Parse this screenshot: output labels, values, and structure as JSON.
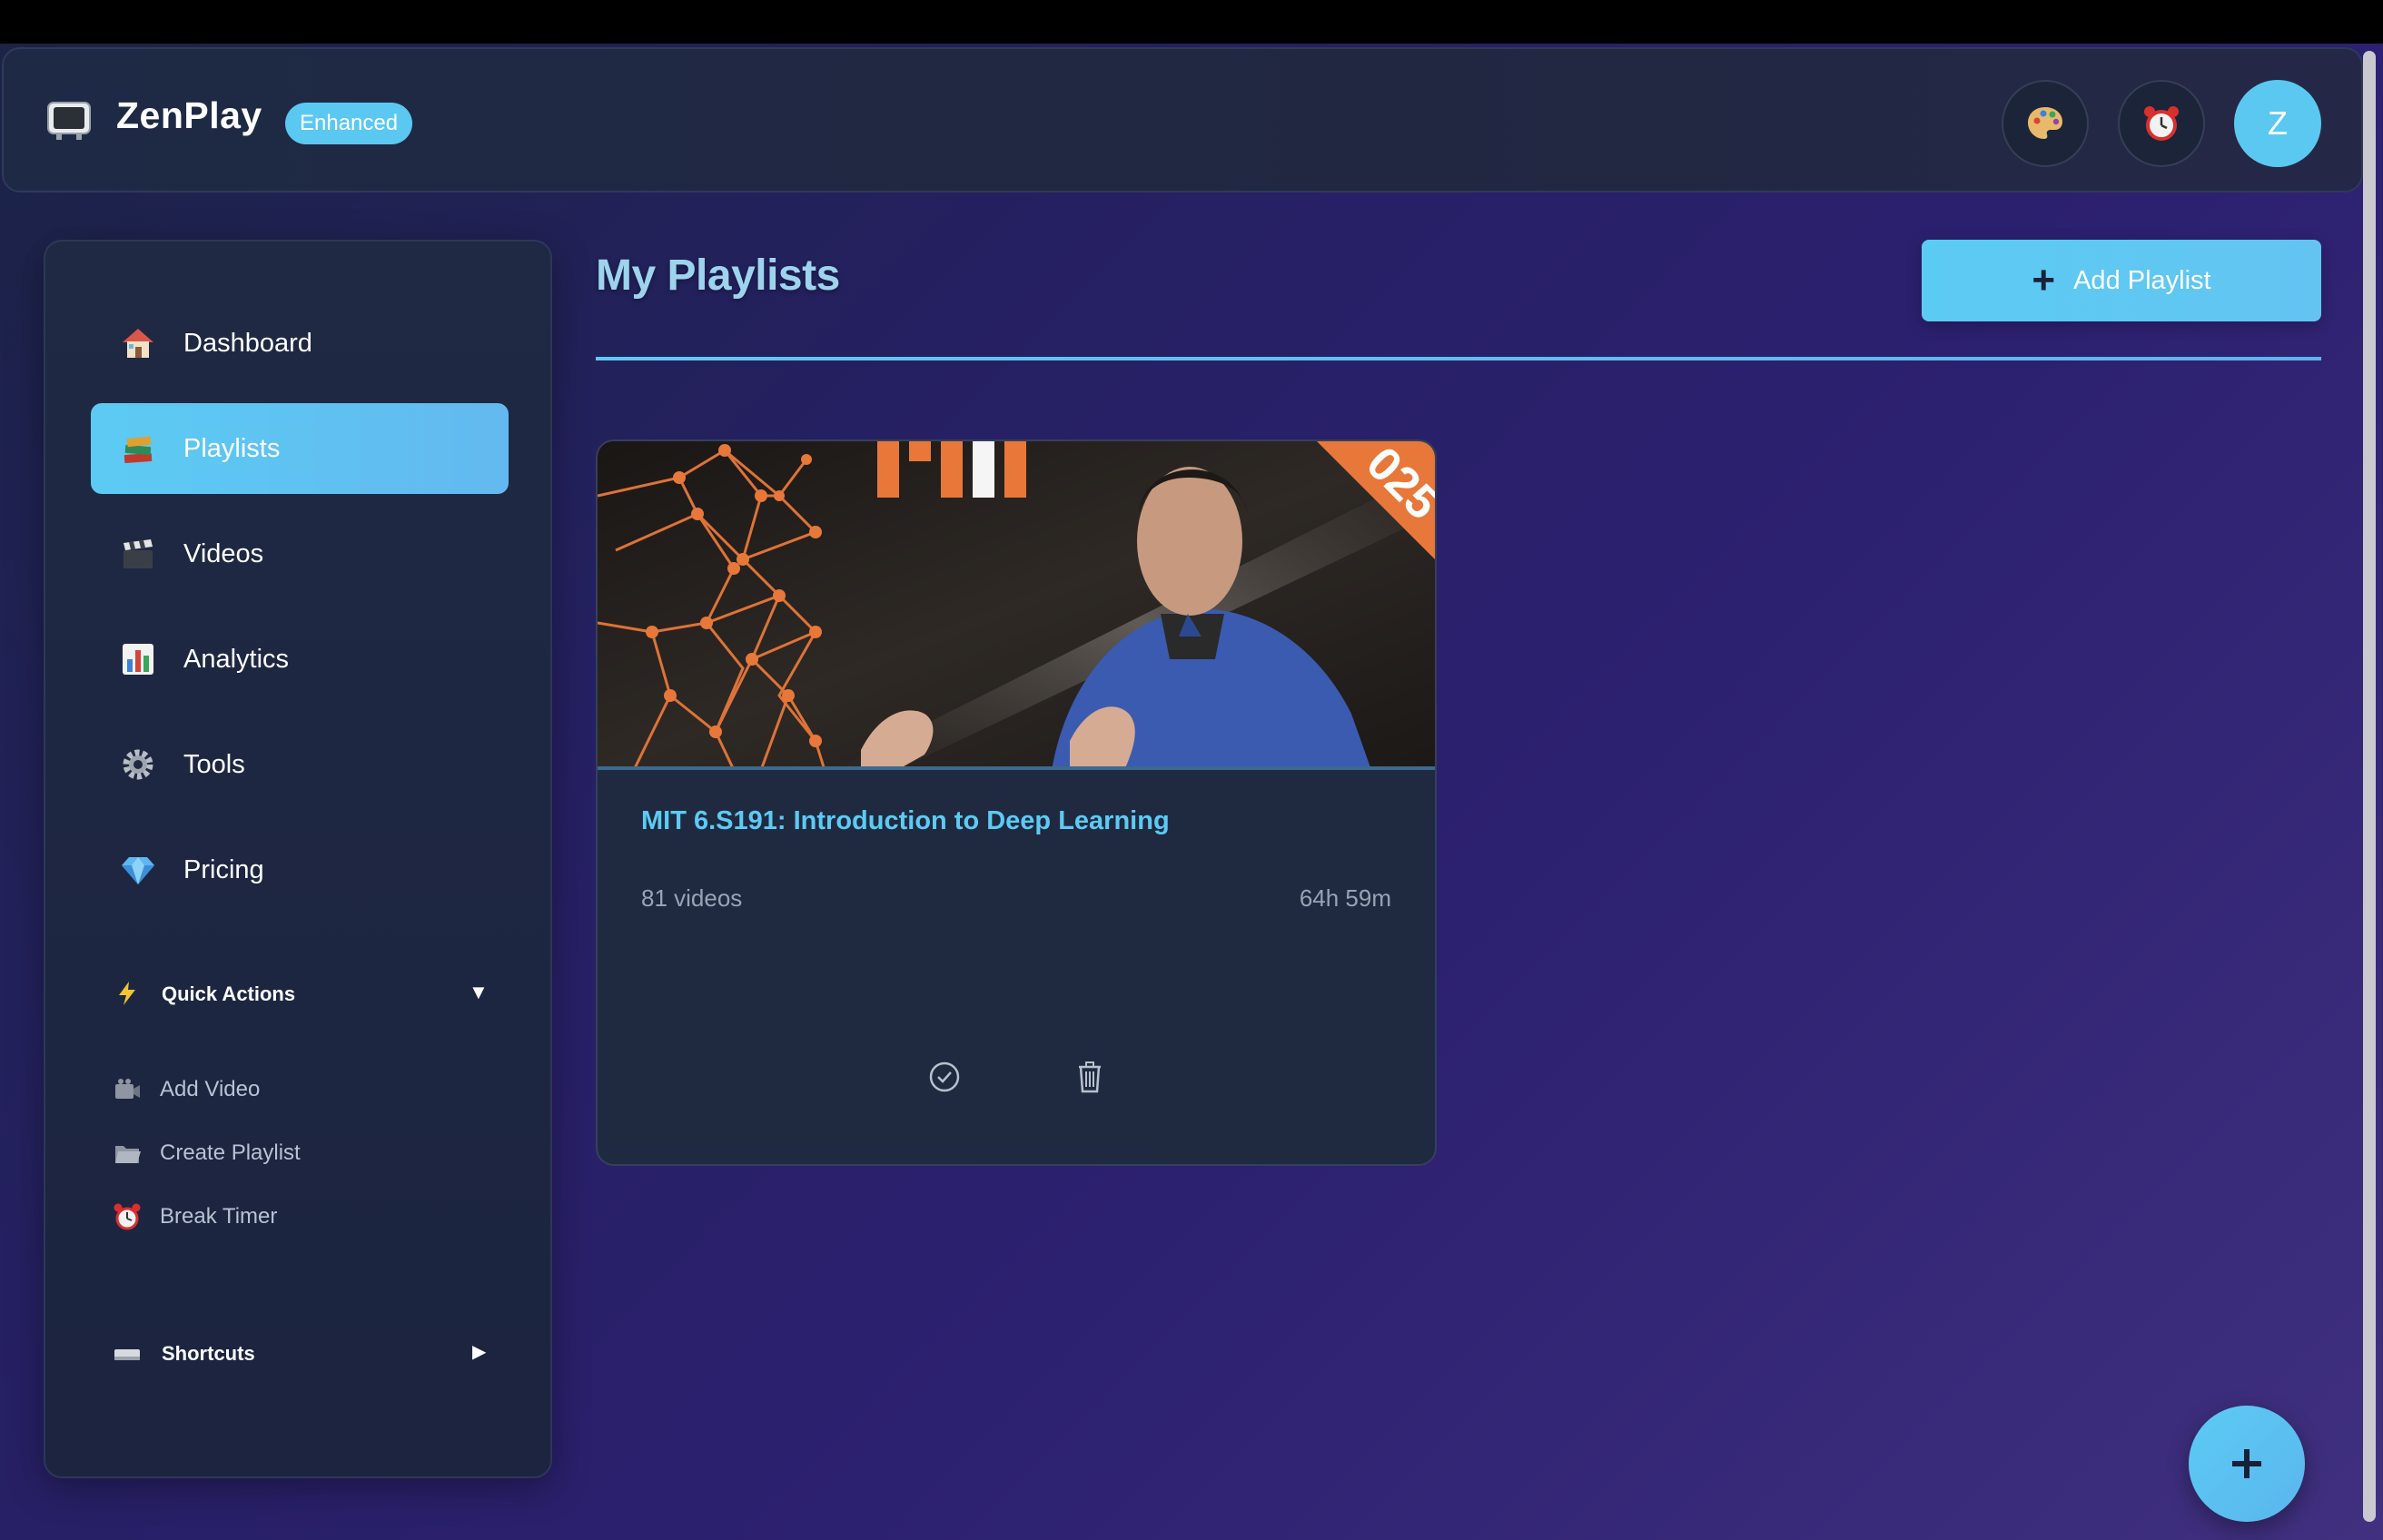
{
  "header": {
    "app_name": "ZenPlay",
    "badge": "Enhanced",
    "logo_icon": "tv-icon",
    "theme_icon": "palette-icon",
    "timer_icon": "alarm-clock-icon",
    "avatar_initial": "Z"
  },
  "sidebar": {
    "items": [
      {
        "label": "Dashboard",
        "icon": "house-icon"
      },
      {
        "label": "Playlists",
        "icon": "books-icon",
        "active": true
      },
      {
        "label": "Videos",
        "icon": "clapper-icon"
      },
      {
        "label": "Analytics",
        "icon": "bar-chart-icon"
      },
      {
        "label": "Tools",
        "icon": "gear-icon"
      },
      {
        "label": "Pricing",
        "icon": "gem-icon"
      }
    ],
    "quick_actions": {
      "title": "Quick Actions",
      "icon": "lightning-icon",
      "items": [
        {
          "label": "Add Video",
          "icon": "video-camera-icon"
        },
        {
          "label": "Create Playlist",
          "icon": "folder-icon"
        },
        {
          "label": "Break Timer",
          "icon": "alarm-clock-icon"
        }
      ]
    },
    "shortcuts": {
      "title": "Shortcuts",
      "icon": "keyboard-icon"
    }
  },
  "main": {
    "title": "My Playlists",
    "add_button_label": "Add Playlist",
    "playlists": [
      {
        "title": "MIT 6.S191: Introduction to Deep Learning",
        "video_count": "81 videos",
        "duration": "64h 59m",
        "thumbnail_corner_text": "025"
      }
    ]
  },
  "colors": {
    "accent": "#5ccbf3",
    "panel": "#1f2a41",
    "background_start": "#1b2346",
    "background_end": "#40307f",
    "mit_orange": "#e8783a"
  }
}
